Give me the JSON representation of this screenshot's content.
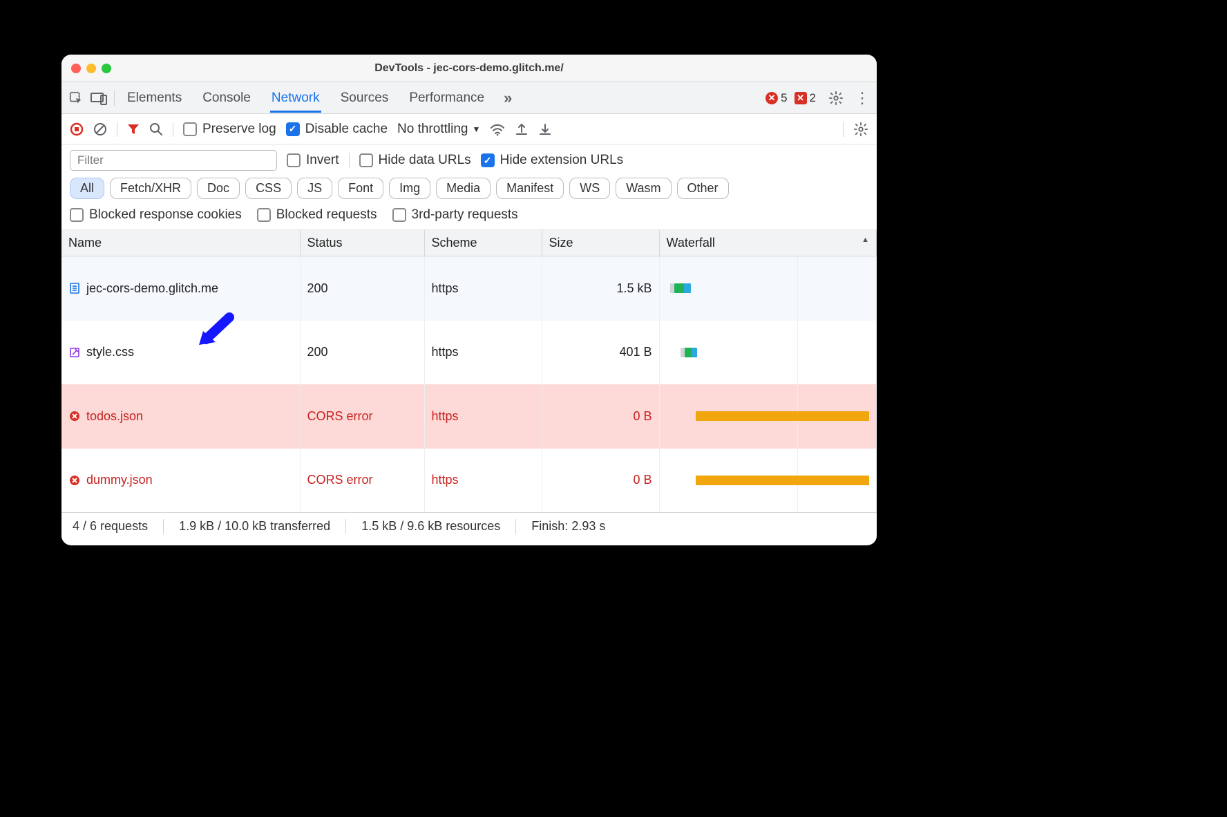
{
  "window": {
    "title": "DevTools - jec-cors-demo.glitch.me/"
  },
  "tabs": {
    "items": [
      "Elements",
      "Console",
      "Network",
      "Sources",
      "Performance"
    ],
    "active": "Network",
    "errors_count": "5",
    "issues_count": "2"
  },
  "toolbar": {
    "preserve_log": "Preserve log",
    "disable_cache": "Disable cache",
    "throttling_label": "No throttling"
  },
  "filter": {
    "placeholder": "Filter",
    "invert": "Invert",
    "hide_data": "Hide data URLs",
    "hide_ext": "Hide extension URLs"
  },
  "chips": [
    "All",
    "Fetch/XHR",
    "Doc",
    "CSS",
    "JS",
    "Font",
    "Img",
    "Media",
    "Manifest",
    "WS",
    "Wasm",
    "Other"
  ],
  "extra": {
    "blocked_cookies": "Blocked response cookies",
    "blocked_requests": "Blocked requests",
    "third_party": "3rd-party requests"
  },
  "columns": {
    "name": "Name",
    "status": "Status",
    "scheme": "Scheme",
    "size": "Size",
    "waterfall": "Waterfall"
  },
  "rows": [
    {
      "name": "jec-cors-demo.glitch.me",
      "status": "200",
      "scheme": "https",
      "size": "1.5 kB",
      "type": "doc",
      "err": false
    },
    {
      "name": "style.css",
      "status": "200",
      "scheme": "https",
      "size": "401 B",
      "type": "css",
      "err": false
    },
    {
      "name": "todos.json",
      "status": "CORS error",
      "scheme": "https",
      "size": "0 B",
      "type": "err",
      "err": true,
      "sel": true
    },
    {
      "name": "dummy.json",
      "status": "CORS error",
      "scheme": "https",
      "size": "0 B",
      "type": "err",
      "err": true
    }
  ],
  "status": {
    "requests": "4 / 6 requests",
    "transferred": "1.9 kB / 10.0 kB transferred",
    "resources": "1.5 kB / 9.6 kB resources",
    "finish": "Finish: 2.93 s"
  }
}
